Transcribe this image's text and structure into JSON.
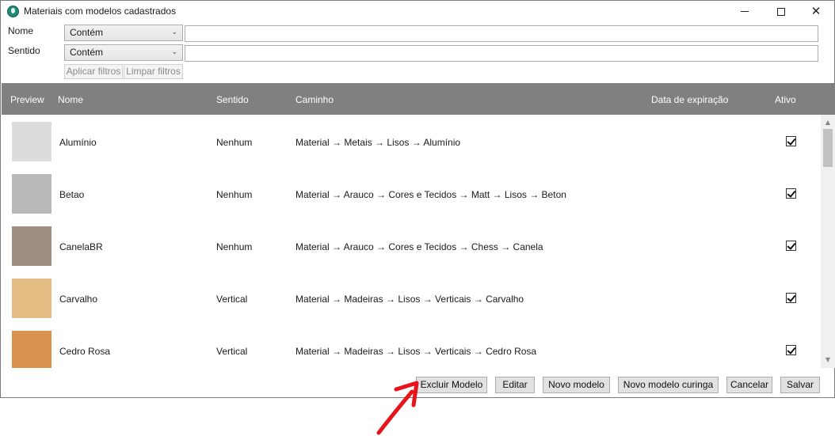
{
  "window": {
    "title": "Materiais com modelos cadastrados",
    "controls": {
      "minimize": "minimize",
      "maximize": "maximize",
      "close": "✕"
    }
  },
  "filters": {
    "nome_label": "Nome",
    "sentido_label": "Sentido",
    "nome_operator": "Contém",
    "sentido_operator": "Contém",
    "nome_value": "",
    "sentido_value": "",
    "apply_label": "Aplicar filtros",
    "clear_label": "Limpar filtros"
  },
  "grid": {
    "columns": {
      "preview": "Preview",
      "nome": "Nome",
      "sentido": "Sentido",
      "caminho": "Caminho",
      "data_expiracao": "Data de expiração",
      "ativo": "Ativo"
    },
    "rows": [
      {
        "nome": "Alumínio",
        "sentido": "Nenhum",
        "caminho": "Material → Metais → Lisos → Alumínio",
        "data_expiracao": "",
        "ativo": true,
        "swatch": "#dcdcdc"
      },
      {
        "nome": "Betao",
        "sentido": "Nenhum",
        "caminho": "Material → Arauco → Cores e Tecidos → Matt → Lisos → Beton",
        "data_expiracao": "",
        "ativo": true,
        "swatch": "#b8b9b8"
      },
      {
        "nome": "CanelaBR",
        "sentido": "Nenhum",
        "caminho": "Material → Arauco → Cores e Tecidos → Chess → Canela",
        "data_expiracao": "",
        "ativo": true,
        "swatch": "#9e8d80"
      },
      {
        "nome": "Carvalho",
        "sentido": "Vertical",
        "caminho": "Material → Madeiras → Lisos → Verticais → Carvalho",
        "data_expiracao": "",
        "ativo": true,
        "swatch": "#e2bc82"
      },
      {
        "nome": "Cedro Rosa",
        "sentido": "Vertical",
        "caminho": "Material → Madeiras → Lisos → Verticais → Cedro Rosa",
        "data_expiracao": "",
        "ativo": true,
        "swatch": "#d9924e"
      }
    ]
  },
  "footer": {
    "excluir": "Excluir Modelo",
    "editar": "Editar",
    "novo": "Novo modelo",
    "curinga": "Novo modelo curinga",
    "cancelar": "Cancelar",
    "salvar": "Salvar"
  },
  "colors": {
    "header_bg": "#808080",
    "annotation_arrow": "#e8141c"
  }
}
